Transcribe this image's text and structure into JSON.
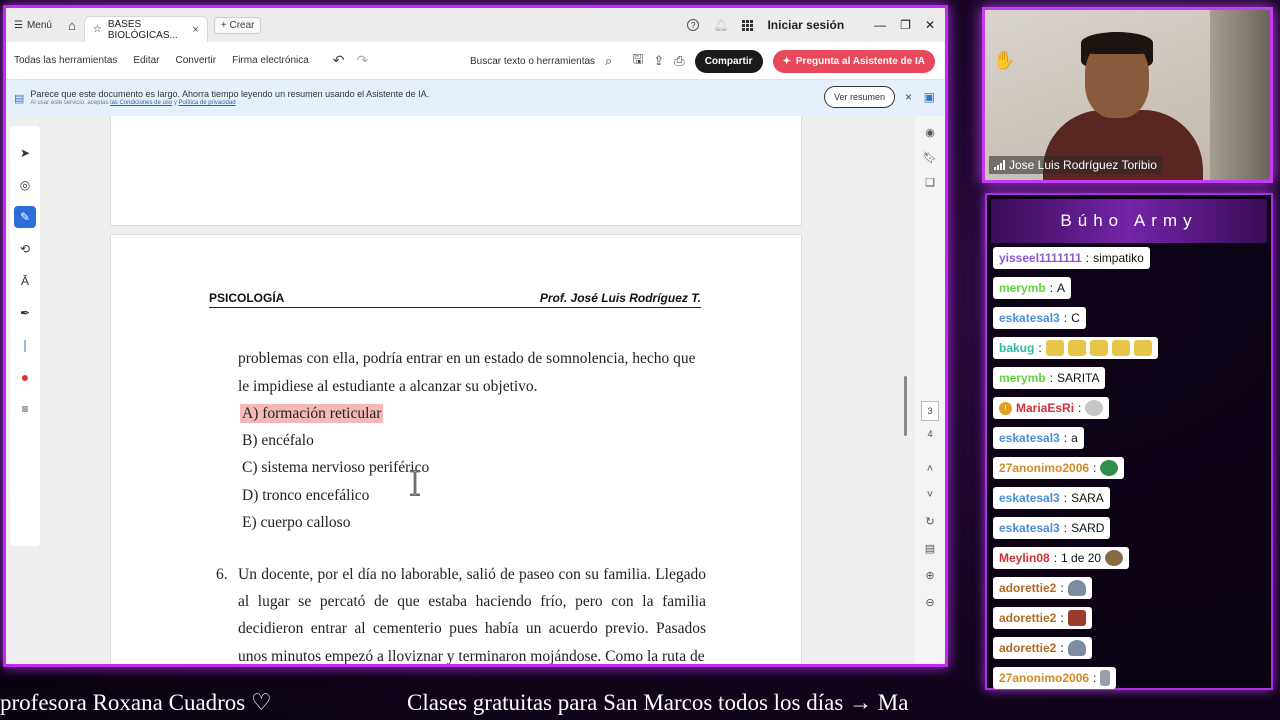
{
  "app": {
    "menu_label": "Menú",
    "tab_title": "BASES BIOLÓGICAS...",
    "new_tab_label": "Crear",
    "signin_label": "Iniciar sesión",
    "toolbar": {
      "items": [
        "Todas las herramientas",
        "Editar",
        "Convertir",
        "Firma electrónica"
      ],
      "search_label": "Buscar texto o herramientas",
      "share_label": "Compartir",
      "ai_label": "Pregunta al Asistente de IA"
    },
    "banner": {
      "text": "Parece que este documento es largo. Ahorra tiempo leyendo un resumen usando el Asistente de IA.",
      "sub_prefix": "Al usar este servicio, aceptas",
      "terms_link": "las Condiciones de uso",
      "sub_mid": "y",
      "privacy_link": "Política de privacidad",
      "summary_button": "Ver resumen"
    },
    "page_numbers": [
      "3",
      "4"
    ]
  },
  "document": {
    "header_left": "PSICOLOGÍA",
    "header_right": "Prof. José Luis Rodríguez T.",
    "paragraph": "problemas con ella, podría entrar en un estado de somnolencia, hecho que le impidiese al estudiante a alcanzar su objetivo.",
    "options": [
      {
        "letter": "A)",
        "text": "formación reticular",
        "highlighted": true
      },
      {
        "letter": "B)",
        "text": "encéfalo",
        "highlighted": false
      },
      {
        "letter": "C)",
        "text": "sistema nervioso periférico",
        "highlighted": false
      },
      {
        "letter": "D)",
        "text": "tronco encefálico",
        "highlighted": false
      },
      {
        "letter": "E)",
        "text": "cuerpo calloso",
        "highlighted": false
      }
    ],
    "question_number": "6.",
    "question_text": "Un docente, por el día no laborable, salió de paseo con su familia. Llegado al lugar se percató de que estaba haciendo frío, pero con la familia decidieron entrar al cementerio pues había un acuerdo previo. Pasados unos minutos empezó a lloviznar y terminaron mojándose. Como la ruta de"
  },
  "webcam": {
    "name": "Jose Luis Rodríguez Toribio"
  },
  "chat": {
    "title": "Búho Army",
    "messages": [
      {
        "user": "yisseel1111111",
        "text": "simpatiko",
        "color": "u-purple",
        "emotes": []
      },
      {
        "user": "merymb",
        "text": "A",
        "color": "u-green",
        "emotes": []
      },
      {
        "user": "eskatesal3",
        "text": "C",
        "color": "u-blue",
        "emotes": []
      },
      {
        "user": "bakug",
        "text": "",
        "color": "u-teal",
        "emotes": [
          "em-frog",
          "em-frog",
          "em-frog",
          "em-frog",
          "em-frog"
        ]
      },
      {
        "user": "merymb",
        "text": "SARITA",
        "color": "u-green",
        "emotes": []
      },
      {
        "user": "MariaEsRi",
        "text": "",
        "color": "u-red",
        "emotes": [
          "em-cat"
        ],
        "badge": true
      },
      {
        "user": "eskatesal3",
        "text": "a",
        "color": "u-blue",
        "emotes": []
      },
      {
        "user": "27anonimo2006",
        "text": "",
        "color": "u-orange",
        "emotes": [
          "em-globe"
        ]
      },
      {
        "user": "eskatesal3",
        "text": "SARA",
        "color": "u-blue",
        "emotes": []
      },
      {
        "user": "eskatesal3",
        "text": "SARD",
        "color": "u-blue",
        "emotes": []
      },
      {
        "user": "Meylin08",
        "text": "1 de 20",
        "color": "u-red",
        "emotes": [
          "em-dog"
        ]
      },
      {
        "user": "adorettie2",
        "text": "",
        "color": "u-brown",
        "emotes": [
          "em-figure"
        ]
      },
      {
        "user": "adorettie2",
        "text": "",
        "color": "u-brown",
        "emotes": [
          "em-brick"
        ]
      },
      {
        "user": "adorettie2",
        "text": "",
        "color": "u-brown",
        "emotes": [
          "em-figure"
        ]
      },
      {
        "user": "27anonimo2006",
        "text": "",
        "color": "u-orange",
        "emotes": [
          "em-small"
        ]
      }
    ]
  },
  "ticker": {
    "left": "profesora Roxana Cuadros ♡",
    "right": "Clases gratuitas para San Marcos todos los días → Ma"
  }
}
